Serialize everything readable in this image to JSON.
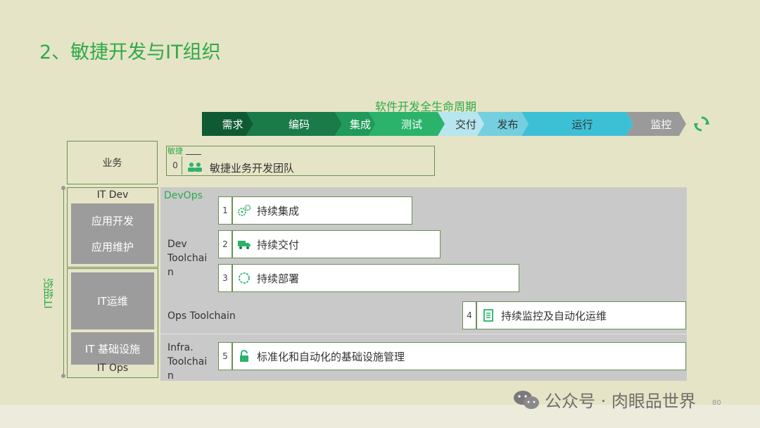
{
  "title": "2、敏捷开发与IT组织",
  "lifecycle": {
    "title": "软件开发全生命周期",
    "stages": [
      {
        "label": "需求",
        "color": "#0e5a33",
        "text_color": "#ffffff"
      },
      {
        "label": "编码",
        "color": "#1a7a48",
        "text_color": "#ffffff"
      },
      {
        "label": "集成",
        "color": "#1f9a5a",
        "text_color": "#ffffff"
      },
      {
        "label": "测试",
        "color": "#2bb36b",
        "text_color": "#ffffff"
      },
      {
        "label": "交付",
        "color": "#b8e6ef",
        "text_color": "#333333"
      },
      {
        "label": "发布",
        "color": "#74cfdf",
        "text_color": "#333333"
      },
      {
        "label": "运行",
        "color": "#3cc0d6",
        "text_color": "#333333"
      },
      {
        "label": "监控",
        "color": "#9a9a9a",
        "text_color": "#ffffff"
      }
    ],
    "cycle_icon": "refresh-icon"
  },
  "business": {
    "label": "业务",
    "agile_tag": "敏捷",
    "item": {
      "num": "0",
      "icon": "team-icon",
      "label": "敏捷业务开发团队"
    }
  },
  "it_org": {
    "label": "IT组织",
    "it_dev": {
      "label": "IT Dev",
      "block_lines": [
        "应用开发",
        "应用维护"
      ]
    },
    "it_ops": {
      "label": "IT Ops",
      "blocks": [
        "IT运维",
        "IT 基础设施"
      ]
    }
  },
  "devops": {
    "label": "DevOps",
    "dev_toolchain": "Dev\nToolchai\nn",
    "ops_toolchain": "Ops Toolchain",
    "infra_toolchain": "Infra.\nToolchai\nn",
    "items": [
      {
        "num": "1",
        "icon": "gears-icon",
        "label": "持续集成"
      },
      {
        "num": "2",
        "icon": "truck-icon",
        "label": "持续交付"
      },
      {
        "num": "3",
        "icon": "circle-dashed-icon",
        "label": "持续部署"
      },
      {
        "num": "4",
        "icon": "checklist-icon",
        "label": "持续监控及自动化运维"
      },
      {
        "num": "5",
        "icon": "lock-icon",
        "label": "标准化和自动化的基础设施管理"
      }
    ]
  },
  "footer": {
    "watermark": "公众号 · 肉眼品世界",
    "page": "80"
  },
  "colors": {
    "accent_green": "#2eaa48",
    "border": "#6b8f55",
    "background": "#e6e4c6"
  }
}
